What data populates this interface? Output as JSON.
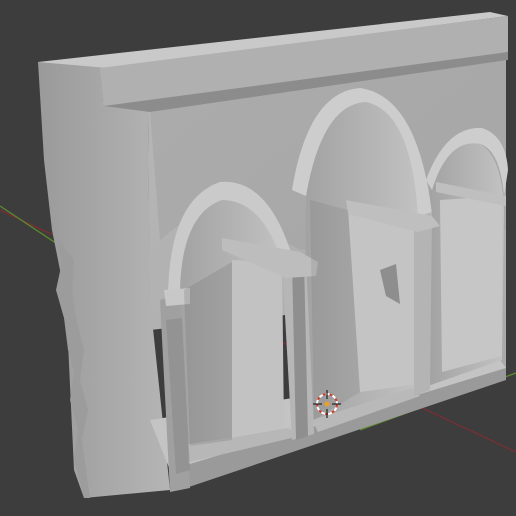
{
  "viewport": {
    "background": "#3d3d3d",
    "x_axis_color": "#7a2f34",
    "y_axis_color": "#5c8a2c",
    "model_base_color": "#b3b3b3",
    "model_light_color": "#c6c6c6",
    "model_dark_color": "#8e8e8e",
    "model_shadow_color": "#6f6f6f",
    "gizmo_icon": "3d-cursor-icon"
  }
}
